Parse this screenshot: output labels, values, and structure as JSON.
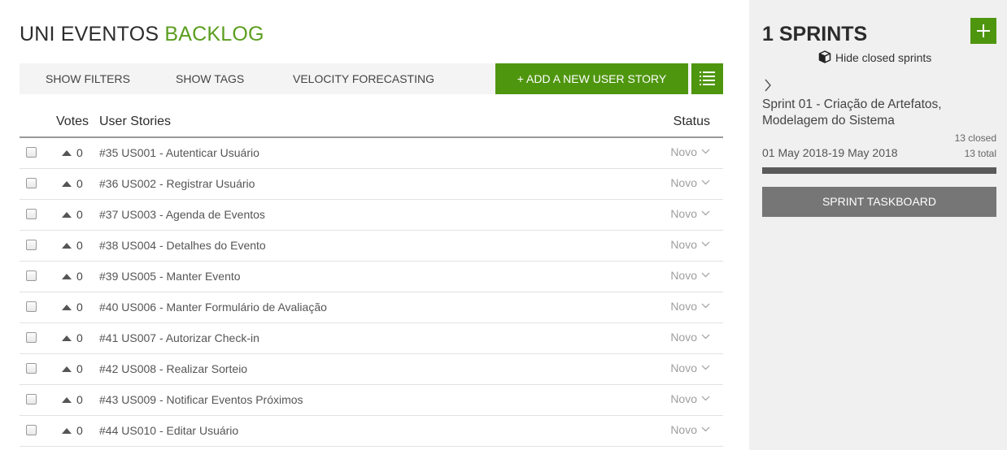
{
  "header": {
    "project_name": "UNI EVENTOS",
    "section_name": "BACKLOG"
  },
  "toolbar": {
    "show_filters": "SHOW FILTERS",
    "show_tags": "SHOW TAGS",
    "velocity_forecasting": "VELOCITY FORECASTING",
    "add_user_story": "+ ADD A NEW USER STORY",
    "list_icon": "list-view-icon"
  },
  "table": {
    "columns": {
      "votes": "Votes",
      "user_stories": "User Stories",
      "status": "Status"
    },
    "rows": [
      {
        "votes": "0",
        "story": "#35 US001 - Autenticar Usuário",
        "status": "Novo"
      },
      {
        "votes": "0",
        "story": "#36 US002 - Registrar Usuário",
        "status": "Novo"
      },
      {
        "votes": "0",
        "story": "#37 US003 - Agenda de Eventos",
        "status": "Novo"
      },
      {
        "votes": "0",
        "story": "#38 US004 - Detalhes do Evento",
        "status": "Novo"
      },
      {
        "votes": "0",
        "story": "#39 US005 - Manter Evento",
        "status": "Novo"
      },
      {
        "votes": "0",
        "story": "#40 US006 - Manter Formulário de Avaliação",
        "status": "Novo"
      },
      {
        "votes": "0",
        "story": "#41 US007 - Autorizar Check-in",
        "status": "Novo"
      },
      {
        "votes": "0",
        "story": "#42 US008 - Realizar Sorteio",
        "status": "Novo"
      },
      {
        "votes": "0",
        "story": "#43 US009 - Notificar Eventos Próximos",
        "status": "Novo"
      },
      {
        "votes": "0",
        "story": "#44 US010 - Editar Usuário",
        "status": "Novo"
      }
    ]
  },
  "sidebar": {
    "title": "1 SPRINTS",
    "hide_closed": "Hide closed sprints",
    "sprint": {
      "name": "Sprint 01 - Criação de Artefatos, Modelagem do Sistema",
      "closed": "13 closed",
      "dates": "01 May 2018-19 May 2018",
      "total": "13 total",
      "progress_fraction": 1.0
    },
    "taskboard_button": "SPRINT TASKBOARD"
  },
  "colors": {
    "accent_green": "#4f960f",
    "title_green": "#5b9e1f",
    "sidebar_bg": "#f0f0f0",
    "taskboard_bg": "#767676"
  }
}
